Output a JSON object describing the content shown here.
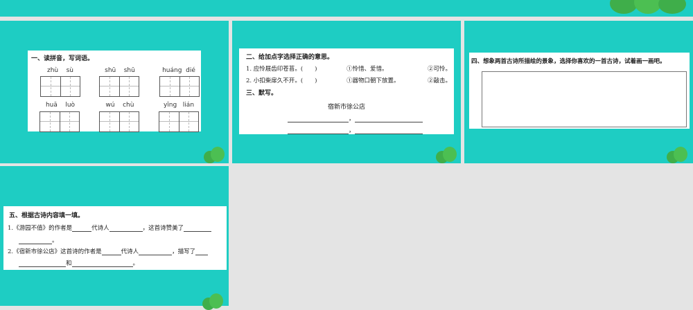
{
  "colors": {
    "teal": "#1ecdc3",
    "background": "#e4e4e4"
  },
  "slide1": {
    "heading": "一、读拼音，写词语。",
    "pinyin": [
      [
        "zhù",
        "sù"
      ],
      [
        "shū",
        "shū"
      ],
      [
        "huáng",
        "dié"
      ],
      [
        "huā",
        "luò"
      ],
      [
        "wú",
        "chù"
      ],
      [
        "yīng",
        "lián"
      ]
    ]
  },
  "slide2": {
    "heading2": "二、给加点字选择正确的意思。",
    "q1": "1. 应怜屐齿印苍苔。(　　)",
    "q1a": "①怜惜、爱惜。",
    "q1b": "②可怜。",
    "q2": "2. 小扣柴扉久不开。(　　)",
    "q2a": "①器物口朝下放置。",
    "q2b": "②敲击。",
    "heading3": "三、默写。",
    "poem_title": "宿新市徐公店",
    "comma": "，"
  },
  "slide3": {
    "heading": "四、想象两首古诗所描绘的景象，选择你喜欢的一首古诗，试着画一画吧。"
  },
  "slide4": {
    "heading": "五、根据古诗内容填一填。",
    "l1a": "1.《游园不值》的作者是",
    "l1b": "代诗人",
    "l1c": "，这首诗赞美了",
    "l1d": "。",
    "l2a": "2.《宿新市徐公店》这首诗的作者是",
    "l2b": "代诗人",
    "l2c": "，描写了",
    "l2d": "和",
    "l2e": "。"
  }
}
